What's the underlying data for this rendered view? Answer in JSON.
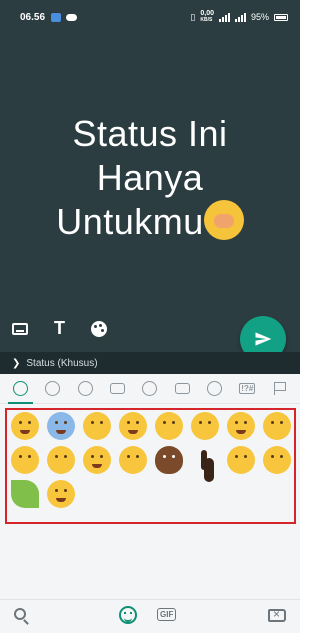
{
  "status_bar": {
    "time": "06.56",
    "data_speed": "0,00",
    "data_unit": "KB/S",
    "battery": "95%"
  },
  "composer": {
    "text_lines": [
      "Status Ini",
      "Hanya",
      "Untukmu"
    ],
    "inline_emoji": "hand-over-mouth-emoji",
    "tools": [
      "keyboard-icon",
      "text-style-icon",
      "palette-icon"
    ],
    "send_icon": "send-icon"
  },
  "audience": {
    "label": "Status (Khusus)"
  },
  "emoji_categories": {
    "items": [
      "recent",
      "smileys",
      "animals",
      "food",
      "activity",
      "travel",
      "objects",
      "symbols",
      "flags"
    ],
    "active": "recent"
  },
  "emoji_grid": {
    "items": [
      "face-with-tears-of-joy",
      "anxious-face-with-sweat",
      "face-with-hand-over-mouth",
      "face-holding-back-tears",
      "face-with-raised-eyebrow",
      "kissing-face",
      "slightly-smiling-face",
      "face-without-mouth",
      "smiling-face-with-hand",
      "face-with-open-eyes-hand-over-mouth",
      "grinning-face",
      "partying-face",
      "pile-of-poo",
      "backhand-index-pointing-up-dark",
      "slightly-frowning-face",
      "smirking-face",
      "leaf",
      "rolling-on-floor-laughing"
    ]
  },
  "bottom_bar": {
    "gif_label": "GIF"
  },
  "colors": {
    "composer_bg": "#2b3d40",
    "send_button": "#12a185",
    "accent": "#0f8f73",
    "selection_outline": "#d6242b"
  }
}
